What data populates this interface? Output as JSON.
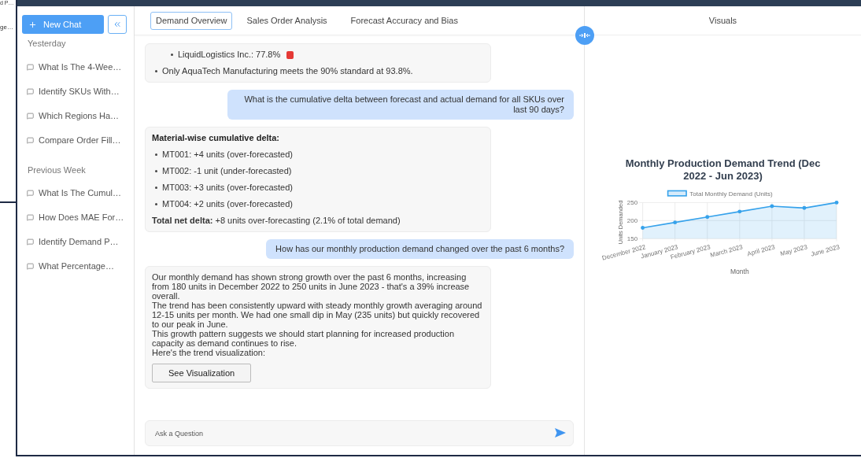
{
  "background_window": {
    "texts": [
      "d P…",
      "ge…"
    ]
  },
  "sidebar": {
    "new_chat": "New Chat",
    "sections": [
      {
        "title": "Yesterday",
        "items": [
          {
            "label": "What Is The 4-Wee…"
          },
          {
            "label": "Identify SKUs With…"
          },
          {
            "label": "Which Regions Ha…"
          },
          {
            "label": "Compare Order Fill…"
          }
        ]
      },
      {
        "title": "Previous Week",
        "items": [
          {
            "label": "What Is The Cumul…"
          },
          {
            "label": "How Does MAE For…"
          },
          {
            "label": "Identify Demand P…"
          },
          {
            "label": "What Percentage…"
          }
        ]
      }
    ]
  },
  "tabs": [
    {
      "label": "Demand Overview",
      "selected": true
    },
    {
      "label": "Sales Order Analysis",
      "selected": false
    },
    {
      "label": "Forecast Accuracy and Bias",
      "selected": false
    }
  ],
  "messages": [
    {
      "kind": "assistant",
      "blocks": [
        {
          "kind": "bullet_list",
          "children": [
            {
              "text": "LiquidLogistics Inc.: 77.8%",
              "alert": true
            }
          ]
        },
        {
          "kind": "bullet",
          "text": "Only AquaTech Manufacturing meets the 90% standard at 93.8%."
        }
      ]
    },
    {
      "kind": "user",
      "text": "What is the cumulative delta between forecast and actual demand for all SKUs over last 90 days?"
    },
    {
      "kind": "assistant",
      "blocks": [
        {
          "kind": "heading",
          "text": "Material-wise cumulative delta:"
        },
        {
          "kind": "bullet",
          "text": "MT001: +4 units (over-forecasted)"
        },
        {
          "kind": "bullet",
          "text": "MT002: -1 unit (under-forecasted)"
        },
        {
          "kind": "bullet",
          "text": "MT003: +3 units (over-forecasted)"
        },
        {
          "kind": "bullet",
          "text": "MT004: +2 units (over-forecasted)"
        },
        {
          "kind": "paragraph",
          "text": "**Total net delta:** +8 units over-forecasting (2.1% of total demand)"
        }
      ]
    },
    {
      "kind": "user",
      "text": "How has our monthly production demand changed over the past 6 months?"
    },
    {
      "kind": "assistant",
      "blocks": [
        {
          "kind": "line",
          "text": "Our monthly demand has shown strong growth over the past 6 months, increasing from 180 units in December 2022 to 250 units in June 2023 - that's a 39% increase overall."
        },
        {
          "kind": "line",
          "text": "The trend has been consistently upward with steady monthly growth averaging around 12-15 units per month. We had one small dip in May (235 units) but quickly recovered to our peak in June."
        },
        {
          "kind": "line",
          "text": "This growth pattern suggests we should start planning for increased production capacity as demand continues to rise."
        },
        {
          "kind": "line",
          "text": "Here's the trend visualization:"
        },
        {
          "kind": "action",
          "text": "See Visualization"
        }
      ]
    }
  ],
  "input": {
    "placeholder": "Ask a Question"
  },
  "visuals": {
    "title": "Visuals",
    "chart_data": {
      "type": "area",
      "grid": true,
      "title": "Monthly Production Demand Trend (Dec 2022 - Jun 2023)",
      "xlabel": "Month",
      "ylabel": "Units Demanded",
      "categories": [
        "December 2022",
        "January 2023",
        "February 2023",
        "March 2023",
        "April 2023",
        "May 2023",
        "June 2023"
      ],
      "series": [
        {
          "name": "Total Monthly Demand (Units)",
          "color": "#36a2eb",
          "values": [
            180,
            195,
            210,
            225,
            240,
            235,
            250
          ]
        }
      ],
      "ylim": [
        150,
        250
      ],
      "yticks": [
        150,
        200,
        250
      ]
    }
  }
}
